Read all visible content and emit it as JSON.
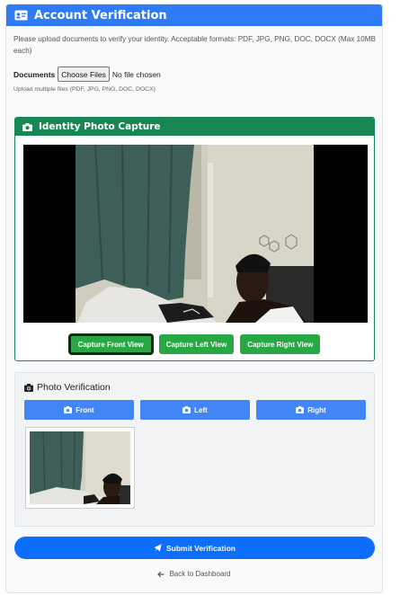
{
  "header": {
    "title": "Account Verification",
    "icon": "id-card-icon"
  },
  "intro": {
    "text": "Please upload documents to verify your identity. Acceptable formats: PDF, JPG, PNG, DOC, DOCX (Max 10MB each)"
  },
  "documents": {
    "label": "Documents",
    "button_label": "Choose Files",
    "status": "No file chosen",
    "hint": "Upload multiple files (PDF, JPG, PNG, DOC, DOCX)"
  },
  "capture": {
    "title": "Identity Photo Capture",
    "icon": "camera-icon",
    "buttons": [
      "Capture Front View",
      "Capture Left View",
      "Capture Right View"
    ],
    "active_index": 0
  },
  "verification": {
    "title": "Photo Verification",
    "icon": "camera-icon",
    "tabs": [
      "Front",
      "Left",
      "Right"
    ]
  },
  "submit": {
    "label": "Submit Verification",
    "icon": "paper-plane-icon"
  },
  "back": {
    "label": "Back to Dashboard",
    "icon": "arrow-left-icon"
  },
  "colors": {
    "primary": "#2f7bf5",
    "success": "#198754",
    "button_green": "#28a745",
    "tab_blue": "#4285f4",
    "submit_blue": "#0d6efd"
  }
}
